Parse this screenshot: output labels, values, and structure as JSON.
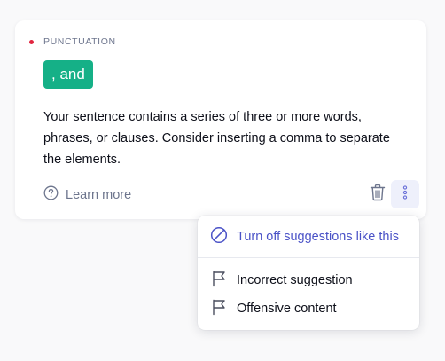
{
  "card": {
    "category": "PUNCTUATION",
    "replacement": ", and",
    "explanation_lines": [
      "Your sentence contains a series of three or more words,",
      "phrases, or clauses. Consider inserting a comma to separate",
      "the elements."
    ],
    "learn_more": "Learn more",
    "icons": {
      "learn_more": "question-circle-icon",
      "dismiss": "trash-icon",
      "more": "more-vertical-icon"
    }
  },
  "menu": {
    "items": [
      {
        "label": "Turn off suggestions like this",
        "icon": "block-icon"
      },
      {
        "label": "Incorrect suggestion",
        "icon": "flag-icon"
      },
      {
        "label": "Offensive content",
        "icon": "flag-icon"
      }
    ]
  },
  "colors": {
    "accent_green": "#15b087",
    "alert_red": "#e1253f",
    "link_blue": "#4a52c7",
    "muted_text": "#6d758d"
  }
}
